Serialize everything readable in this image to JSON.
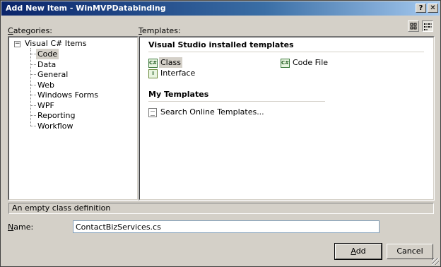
{
  "window": {
    "title": "Add New Item - WinMVPDatabinding"
  },
  "titlebar": {
    "help_label": "?",
    "close_label": "✕"
  },
  "categories": {
    "label_hotkey": "C",
    "label_rest": "ategories:",
    "root": {
      "label": "Visual C# Items",
      "toggle": "−"
    },
    "items": [
      {
        "label": "Code",
        "selected": true
      },
      {
        "label": "Data"
      },
      {
        "label": "General"
      },
      {
        "label": "Web"
      },
      {
        "label": "Windows Forms"
      },
      {
        "label": "WPF"
      },
      {
        "label": "Reporting"
      },
      {
        "label": "Workflow"
      }
    ]
  },
  "templates": {
    "label_hotkey": "T",
    "label_rest": "emplates:",
    "installed_heading": "Visual Studio installed templates",
    "installed": [
      {
        "label": "Class",
        "icon": "csharp-class-icon",
        "selected": true
      },
      {
        "label": "Code File",
        "icon": "csharp-code-file-icon"
      },
      {
        "label": "Interface",
        "icon": "csharp-interface-icon"
      }
    ],
    "my_heading": "My Templates",
    "my": [
      {
        "label": "Search Online Templates...",
        "icon": "search-online-icon"
      }
    ]
  },
  "view_buttons": {
    "large_icons": "large-icons-view-icon",
    "small_icons": "small-icons-view-icon"
  },
  "description": "An empty class definition",
  "name": {
    "label_hotkey": "N",
    "label_rest": "ame:",
    "value": "ContactBizServices.cs"
  },
  "buttons": {
    "add_hotkey": "A",
    "add_rest": "dd",
    "cancel": "Cancel"
  },
  "colors": {
    "title_start": "#0a246a",
    "title_end": "#a6caf0",
    "dialog_bg": "#d4d0c8"
  }
}
